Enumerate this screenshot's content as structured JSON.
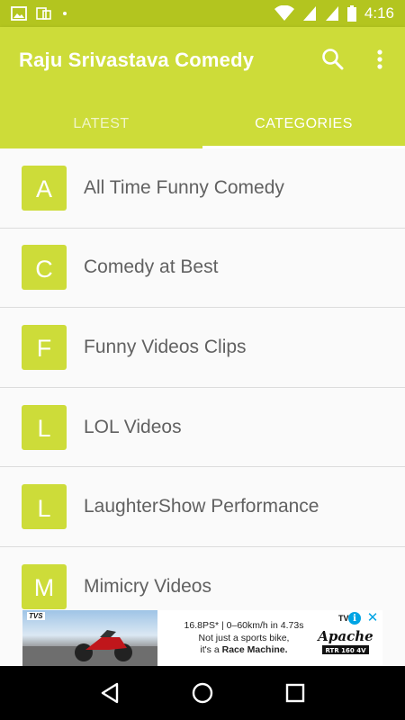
{
  "status_bar": {
    "time": "4:16",
    "icons": [
      "image-icon",
      "screenshot-icon",
      "dot-icon",
      "wifi-icon",
      "signal-icon",
      "signal-icon",
      "battery-icon"
    ]
  },
  "app_bar": {
    "title": "Raju Srivastava Comedy",
    "actions": [
      "search-icon",
      "more-vert-icon"
    ],
    "background_color": "#cddc39",
    "status_bar_color": "#b3c51f"
  },
  "tabs": [
    {
      "label": "LATEST",
      "active": false
    },
    {
      "label": "CATEGORIES",
      "active": true
    }
  ],
  "categories": [
    {
      "letter": "A",
      "label": "All Time Funny Comedy"
    },
    {
      "letter": "C",
      "label": "Comedy at Best"
    },
    {
      "letter": "F",
      "label": "Funny Videos Clips"
    },
    {
      "letter": "L",
      "label": "LOL Videos"
    },
    {
      "letter": "L",
      "label": "LaughterShow Performance"
    },
    {
      "letter": "M",
      "label": "Mimicry Videos"
    }
  ],
  "ad": {
    "brand": "TVS",
    "line1": "16.8PS* | 0–60km/h in 4.73s",
    "line2": "Not just a sports bike,",
    "line3_prefix": "it's a ",
    "line3_bold": "Race Machine.",
    "logo_text": "Apache",
    "logo_sub": "RTR 160 4V",
    "info_label": "i",
    "close_label": "✕"
  },
  "nav_bar": {
    "buttons": [
      "back-icon",
      "home-icon",
      "recents-icon"
    ]
  }
}
